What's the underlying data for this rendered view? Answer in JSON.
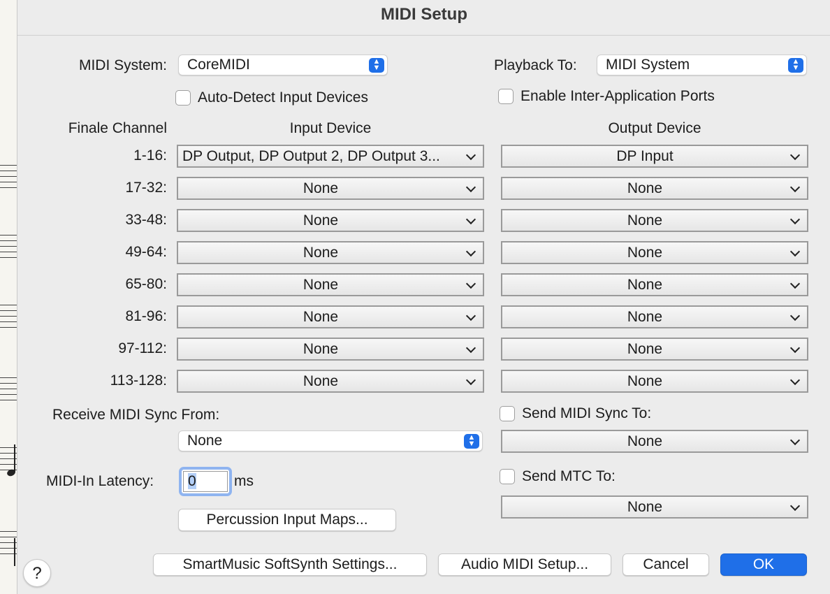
{
  "window": {
    "title": "MIDI Setup"
  },
  "midi_system": {
    "label": "MIDI System:",
    "value": "CoreMIDI"
  },
  "playback": {
    "label": "Playback To:",
    "value": "MIDI System"
  },
  "auto_detect": {
    "label": "Auto-Detect Input Devices",
    "checked": false
  },
  "inter_app": {
    "label": "Enable Inter-Application Ports",
    "checked": false
  },
  "table": {
    "headers": {
      "channel": "Finale Channel",
      "input": "Input Device",
      "output": "Output Device"
    },
    "rows": [
      {
        "channel": "1-16:",
        "input": "DP Output, DP Output 2, DP Output 3...",
        "output": "DP Input"
      },
      {
        "channel": "17-32:",
        "input": "None",
        "output": "None"
      },
      {
        "channel": "33-48:",
        "input": "None",
        "output": "None"
      },
      {
        "channel": "49-64:",
        "input": "None",
        "output": "None"
      },
      {
        "channel": "65-80:",
        "input": "None",
        "output": "None"
      },
      {
        "channel": "81-96:",
        "input": "None",
        "output": "None"
      },
      {
        "channel": "97-112:",
        "input": "None",
        "output": "None"
      },
      {
        "channel": "113-128:",
        "input": "None",
        "output": "None"
      }
    ]
  },
  "receive_sync": {
    "label": "Receive MIDI Sync From:",
    "value": "None"
  },
  "send_sync": {
    "label": "Send MIDI Sync To:",
    "value": "None",
    "checked": false
  },
  "send_mtc": {
    "label": "Send MTC To:",
    "value": "None",
    "checked": false
  },
  "latency": {
    "label": "MIDI-In Latency:",
    "value": "0",
    "unit": "ms"
  },
  "buttons": {
    "percussion": "Percussion Input Maps...",
    "smartmusic": "SmartMusic SoftSynth Settings...",
    "audio_midi": "Audio MIDI Setup...",
    "cancel": "Cancel",
    "ok": "OK",
    "help": "?"
  },
  "icons": {
    "stepper": "up-down-stepper-icon",
    "dropdown": "chevron-down-icon",
    "help": "help-icon"
  },
  "colors": {
    "accent": "#1f6fe8",
    "focus_ring": "#8fb4f0",
    "dialog_bg": "#ececec"
  }
}
